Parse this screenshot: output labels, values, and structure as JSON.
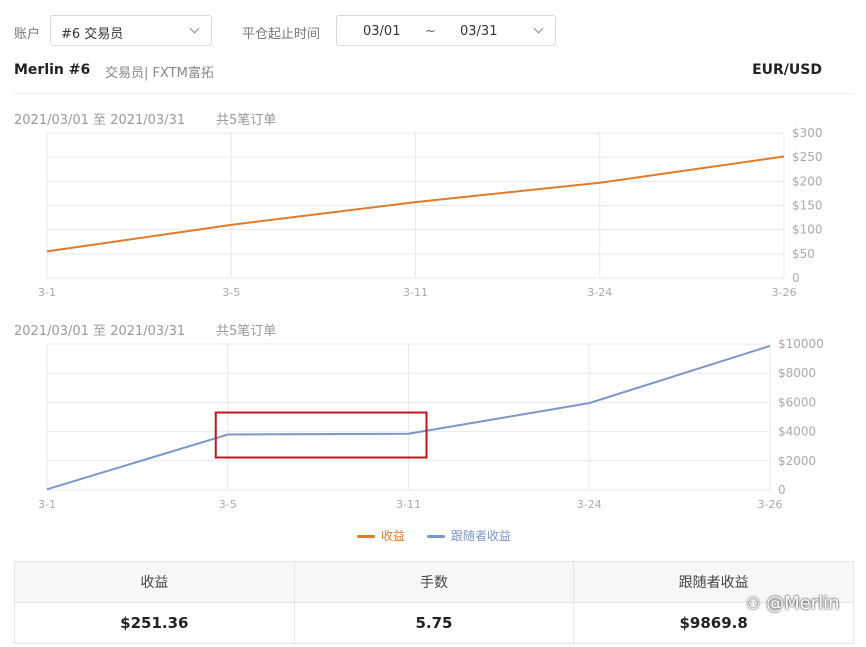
{
  "filters": {
    "account_label": "账户",
    "account_value": "#6 交易员",
    "time_label": "平仓起止时间",
    "date_start": "03/01",
    "date_sep": "~",
    "date_end": "03/31"
  },
  "header": {
    "trader_name": "Merlin #6",
    "trader_sub": "交易员| FXTM富拓",
    "symbol": "EUR/USD"
  },
  "chart_data": [
    {
      "type": "line",
      "title": "2021/03/01 至 2021/03/31",
      "subtitle": "共5笔订单",
      "categories": [
        "3-1",
        "3-5",
        "3-11",
        "3-24",
        "3-26"
      ],
      "series": [
        {
          "name": "收益",
          "color": "#e07b2a",
          "values": [
            55,
            110,
            157,
            197,
            251.36
          ]
        }
      ],
      "yticks": [
        "0",
        "$50",
        "$100",
        "$150",
        "$200",
        "$250",
        "$300"
      ],
      "ylim": [
        0,
        300
      ],
      "y_axis_position": "right",
      "grid": true
    },
    {
      "type": "line",
      "title": "2021/03/01 至 2021/03/31",
      "subtitle": "共5笔订单",
      "categories": [
        "3-1",
        "3-5",
        "3-11",
        "3-24",
        "3-26"
      ],
      "series": [
        {
          "name": "跟随者收益",
          "color": "#7b96c9",
          "values": [
            50,
            3800,
            3850,
            5950,
            9869.8
          ]
        }
      ],
      "yticks": [
        "0",
        "$2000",
        "$4000",
        "$6000",
        "$8000",
        "$10000"
      ],
      "ylim": [
        0,
        10000
      ],
      "y_axis_position": "right",
      "grid": true,
      "highlight_range": [
        "3-5",
        "3-11"
      ],
      "highlight_color": "#c0161c"
    }
  ],
  "legend": [
    {
      "label": "收益",
      "color": "#e07b2a"
    },
    {
      "label": "跟随者收益",
      "color": "#7b96c9"
    }
  ],
  "stats": {
    "headers": [
      "收益",
      "手数",
      "跟随者收益"
    ],
    "values": [
      "$251.36",
      "5.75",
      "$9869.8"
    ]
  },
  "watermark": "@Merlin"
}
